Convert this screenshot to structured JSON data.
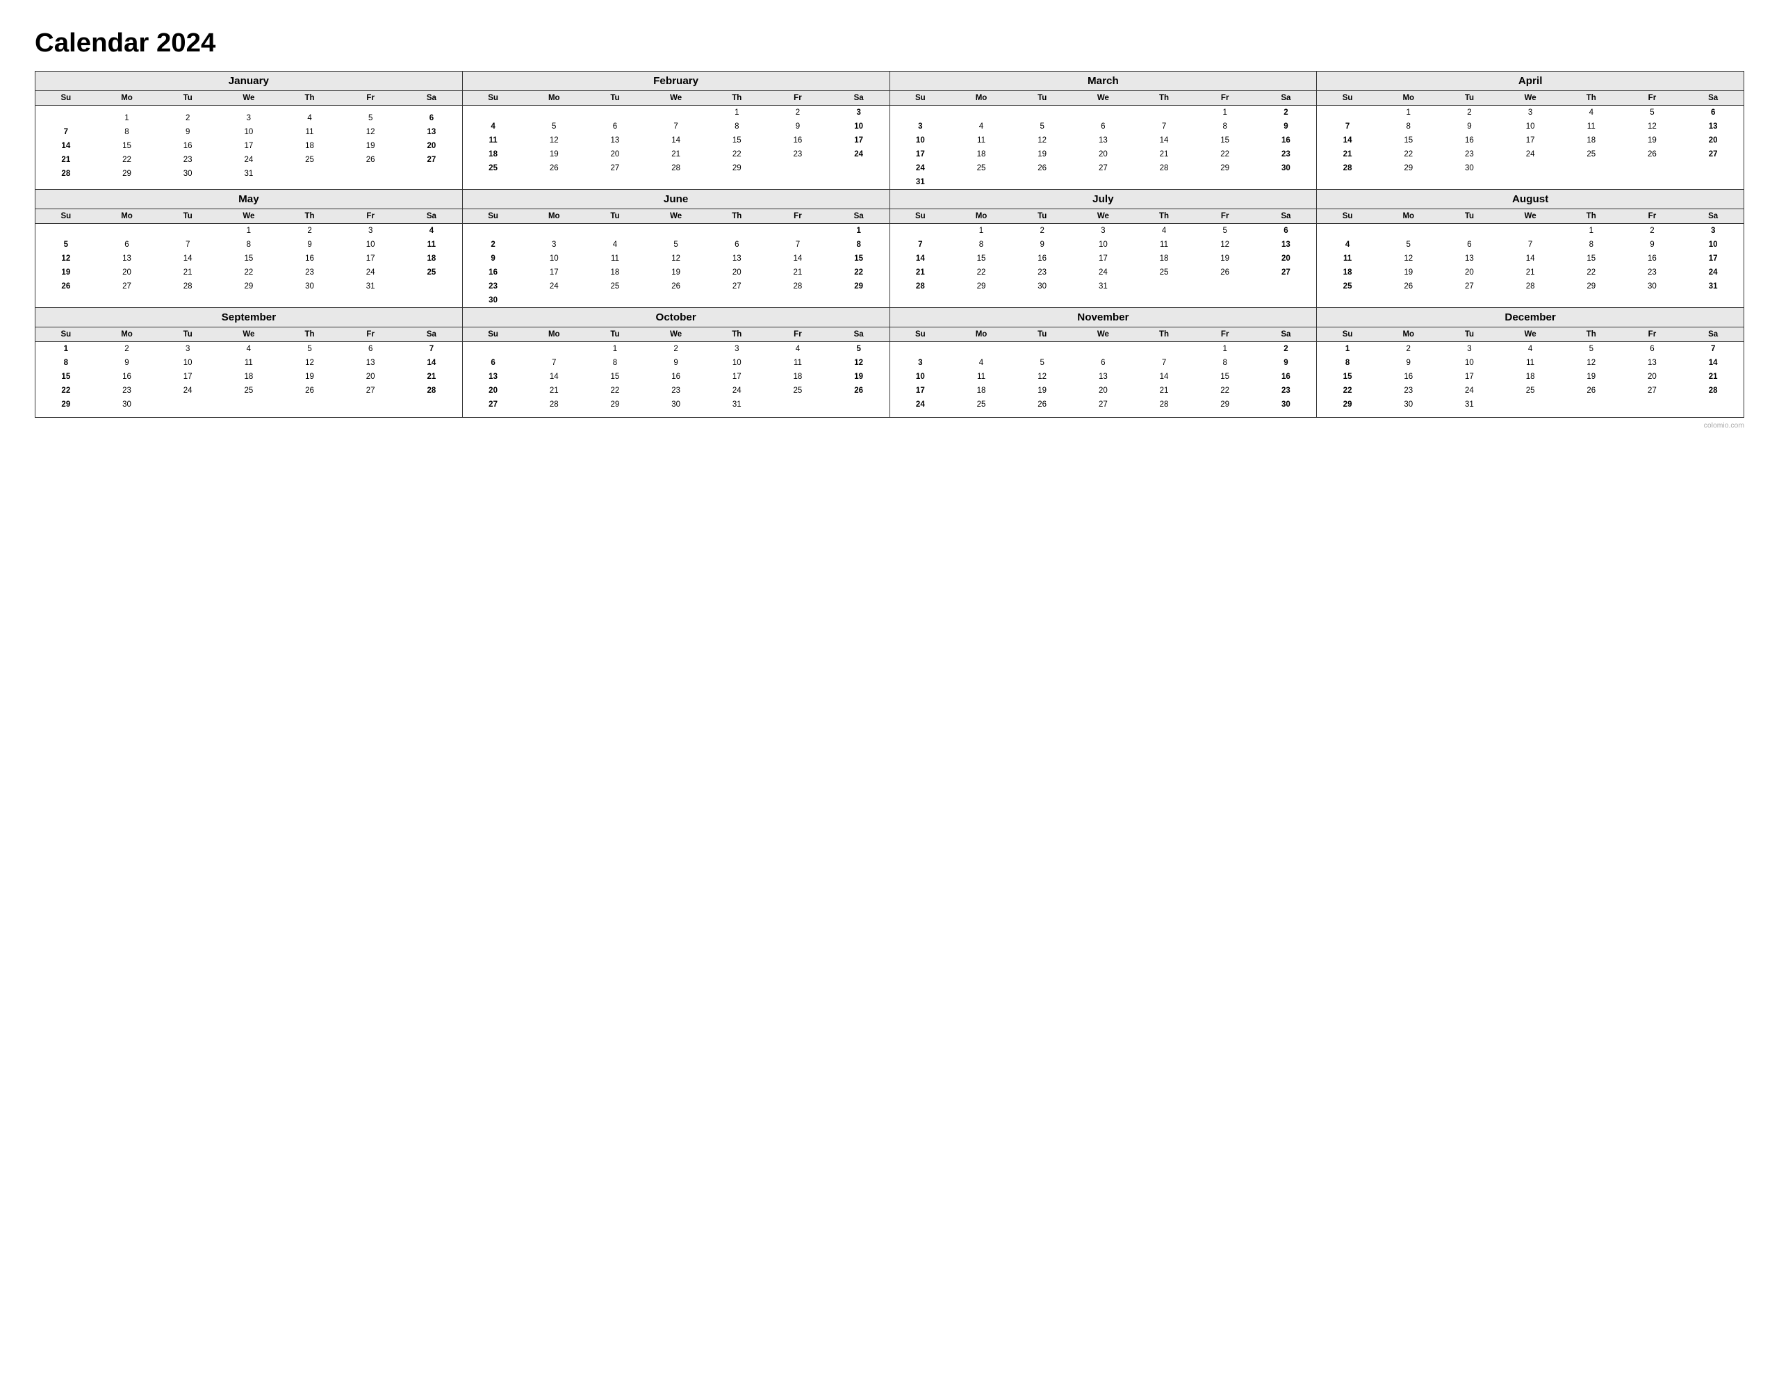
{
  "title": "Calendar 2024",
  "footer": "colomio.com",
  "months": [
    {
      "name": "January",
      "weeks": [
        [
          "",
          "",
          "",
          "",
          "",
          "",
          ""
        ],
        [
          "",
          "1",
          "2",
          "3",
          "4",
          "5",
          "6"
        ],
        [
          "7",
          "8",
          "9",
          "10",
          "11",
          "12",
          "13"
        ],
        [
          "14",
          "15",
          "16",
          "17",
          "18",
          "19",
          "20"
        ],
        [
          "21",
          "22",
          "23",
          "24",
          "25",
          "26",
          "27"
        ],
        [
          "28",
          "29",
          "30",
          "31",
          "",
          "",
          ""
        ]
      ]
    },
    {
      "name": "February",
      "weeks": [
        [
          "",
          "",
          "",
          "",
          "1",
          "2",
          "3"
        ],
        [
          "4",
          "5",
          "6",
          "7",
          "8",
          "9",
          "10"
        ],
        [
          "11",
          "12",
          "13",
          "14",
          "15",
          "16",
          "17"
        ],
        [
          "18",
          "19",
          "20",
          "21",
          "22",
          "23",
          "24"
        ],
        [
          "25",
          "26",
          "27",
          "28",
          "29",
          "",
          ""
        ],
        [
          "",
          "",
          "",
          "",
          "",
          "",
          ""
        ]
      ]
    },
    {
      "name": "March",
      "weeks": [
        [
          "",
          "",
          "",
          "",
          "",
          "1",
          "2"
        ],
        [
          "3",
          "4",
          "5",
          "6",
          "7",
          "8",
          "9"
        ],
        [
          "10",
          "11",
          "12",
          "13",
          "14",
          "15",
          "16"
        ],
        [
          "17",
          "18",
          "19",
          "20",
          "21",
          "22",
          "23"
        ],
        [
          "24",
          "25",
          "26",
          "27",
          "28",
          "29",
          "30"
        ],
        [
          "31",
          "",
          "",
          "",
          "",
          "",
          ""
        ]
      ]
    },
    {
      "name": "April",
      "weeks": [
        [
          "",
          "1",
          "2",
          "3",
          "4",
          "5",
          "6"
        ],
        [
          "7",
          "8",
          "9",
          "10",
          "11",
          "12",
          "13"
        ],
        [
          "14",
          "15",
          "16",
          "17",
          "18",
          "19",
          "20"
        ],
        [
          "21",
          "22",
          "23",
          "24",
          "25",
          "26",
          "27"
        ],
        [
          "28",
          "29",
          "30",
          "",
          "",
          "",
          ""
        ],
        [
          "",
          "",
          "",
          "",
          "",
          "",
          ""
        ]
      ]
    },
    {
      "name": "May",
      "weeks": [
        [
          "",
          "",
          "",
          "1",
          "2",
          "3",
          "4"
        ],
        [
          "5",
          "6",
          "7",
          "8",
          "9",
          "10",
          "11"
        ],
        [
          "12",
          "13",
          "14",
          "15",
          "16",
          "17",
          "18"
        ],
        [
          "19",
          "20",
          "21",
          "22",
          "23",
          "24",
          "25"
        ],
        [
          "26",
          "27",
          "28",
          "29",
          "30",
          "31",
          ""
        ],
        [
          "",
          "",
          "",
          "",
          "",
          "",
          ""
        ]
      ]
    },
    {
      "name": "June",
      "weeks": [
        [
          "",
          "",
          "",
          "",
          "",
          "",
          "1"
        ],
        [
          "2",
          "3",
          "4",
          "5",
          "6",
          "7",
          "8"
        ],
        [
          "9",
          "10",
          "11",
          "12",
          "13",
          "14",
          "15"
        ],
        [
          "16",
          "17",
          "18",
          "19",
          "20",
          "21",
          "22"
        ],
        [
          "23",
          "24",
          "25",
          "26",
          "27",
          "28",
          "29"
        ],
        [
          "30",
          "",
          "",
          "",
          "",
          "",
          ""
        ]
      ]
    },
    {
      "name": "July",
      "weeks": [
        [
          "",
          "1",
          "2",
          "3",
          "4",
          "5",
          "6"
        ],
        [
          "7",
          "8",
          "9",
          "10",
          "11",
          "12",
          "13"
        ],
        [
          "14",
          "15",
          "16",
          "17",
          "18",
          "19",
          "20"
        ],
        [
          "21",
          "22",
          "23",
          "24",
          "25",
          "26",
          "27"
        ],
        [
          "28",
          "29",
          "30",
          "31",
          "",
          "",
          ""
        ],
        [
          "",
          "",
          "",
          "",
          "",
          "",
          ""
        ]
      ]
    },
    {
      "name": "August",
      "weeks": [
        [
          "",
          "",
          "",
          "",
          "1",
          "2",
          "3"
        ],
        [
          "4",
          "5",
          "6",
          "7",
          "8",
          "9",
          "10"
        ],
        [
          "11",
          "12",
          "13",
          "14",
          "15",
          "16",
          "17"
        ],
        [
          "18",
          "19",
          "20",
          "21",
          "22",
          "23",
          "24"
        ],
        [
          "25",
          "26",
          "27",
          "28",
          "29",
          "30",
          "31"
        ],
        [
          "",
          "",
          "",
          "",
          "",
          "",
          ""
        ]
      ]
    },
    {
      "name": "September",
      "weeks": [
        [
          "1",
          "2",
          "3",
          "4",
          "5",
          "6",
          "7"
        ],
        [
          "8",
          "9",
          "10",
          "11",
          "12",
          "13",
          "14"
        ],
        [
          "15",
          "16",
          "17",
          "18",
          "19",
          "20",
          "21"
        ],
        [
          "22",
          "23",
          "24",
          "25",
          "26",
          "27",
          "28"
        ],
        [
          "29",
          "30",
          "",
          "",
          "",
          "",
          ""
        ],
        [
          "",
          "",
          "",
          "",
          "",
          "",
          ""
        ]
      ]
    },
    {
      "name": "October",
      "weeks": [
        [
          "",
          "",
          "1",
          "2",
          "3",
          "4",
          "5"
        ],
        [
          "6",
          "7",
          "8",
          "9",
          "10",
          "11",
          "12"
        ],
        [
          "13",
          "14",
          "15",
          "16",
          "17",
          "18",
          "19"
        ],
        [
          "20",
          "21",
          "22",
          "23",
          "24",
          "25",
          "26"
        ],
        [
          "27",
          "28",
          "29",
          "30",
          "31",
          "",
          ""
        ],
        [
          "",
          "",
          "",
          "",
          "",
          "",
          ""
        ]
      ]
    },
    {
      "name": "November",
      "weeks": [
        [
          "",
          "",
          "",
          "",
          "",
          "1",
          "2"
        ],
        [
          "3",
          "4",
          "5",
          "6",
          "7",
          "8",
          "9"
        ],
        [
          "10",
          "11",
          "12",
          "13",
          "14",
          "15",
          "16"
        ],
        [
          "17",
          "18",
          "19",
          "20",
          "21",
          "22",
          "23"
        ],
        [
          "24",
          "25",
          "26",
          "27",
          "28",
          "29",
          "30"
        ],
        [
          "",
          "",
          "",
          "",
          "",
          "",
          ""
        ]
      ]
    },
    {
      "name": "December",
      "weeks": [
        [
          "1",
          "2",
          "3",
          "4",
          "5",
          "6",
          "7"
        ],
        [
          "8",
          "9",
          "10",
          "11",
          "12",
          "13",
          "14"
        ],
        [
          "15",
          "16",
          "17",
          "18",
          "19",
          "20",
          "21"
        ],
        [
          "22",
          "23",
          "24",
          "25",
          "26",
          "27",
          "28"
        ],
        [
          "29",
          "30",
          "31",
          "",
          "",
          "",
          ""
        ],
        [
          "",
          "",
          "",
          "",
          "",
          "",
          ""
        ]
      ]
    }
  ],
  "dayHeaders": [
    "Su",
    "Mo",
    "Tu",
    "We",
    "Th",
    "Fr",
    "Sa"
  ]
}
